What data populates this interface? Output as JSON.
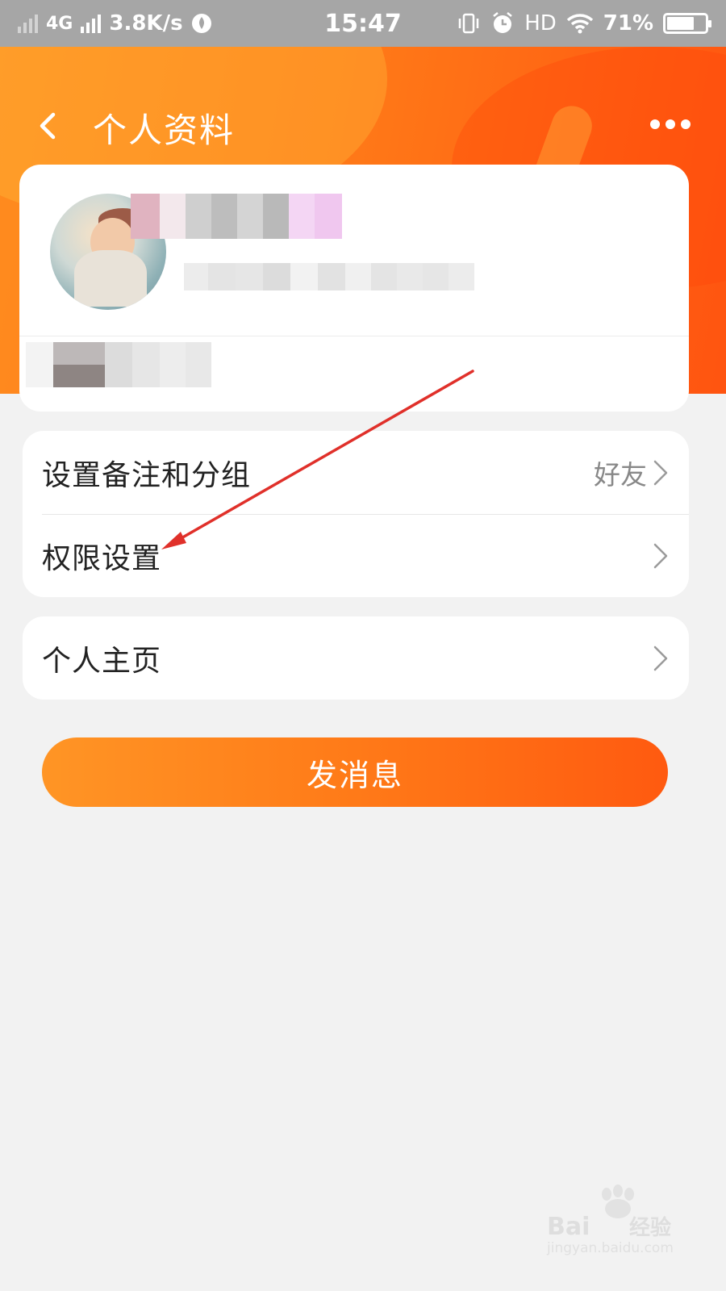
{
  "status_bar": {
    "network": "4G",
    "speed": "3.8K/s",
    "time": "15:47",
    "hd": "HD",
    "battery": "71%",
    "battery_level": 0.71
  },
  "header": {
    "title": "个人资料"
  },
  "settings": {
    "remark_label": "设置备注和分组",
    "remark_value": "好友",
    "permission_label": "权限设置"
  },
  "homepage": {
    "label": "个人主页"
  },
  "send_button": {
    "label": "发消息"
  },
  "colors": {
    "accent": "#ff7a18",
    "annotation_arrow": "#e0302a"
  },
  "icons": {
    "back": "back-icon",
    "more": "more-icon",
    "chevron": "chevron-right-icon"
  },
  "watermark": {
    "logo": "Baidu经验",
    "url": "jingyan.baidu.com"
  }
}
